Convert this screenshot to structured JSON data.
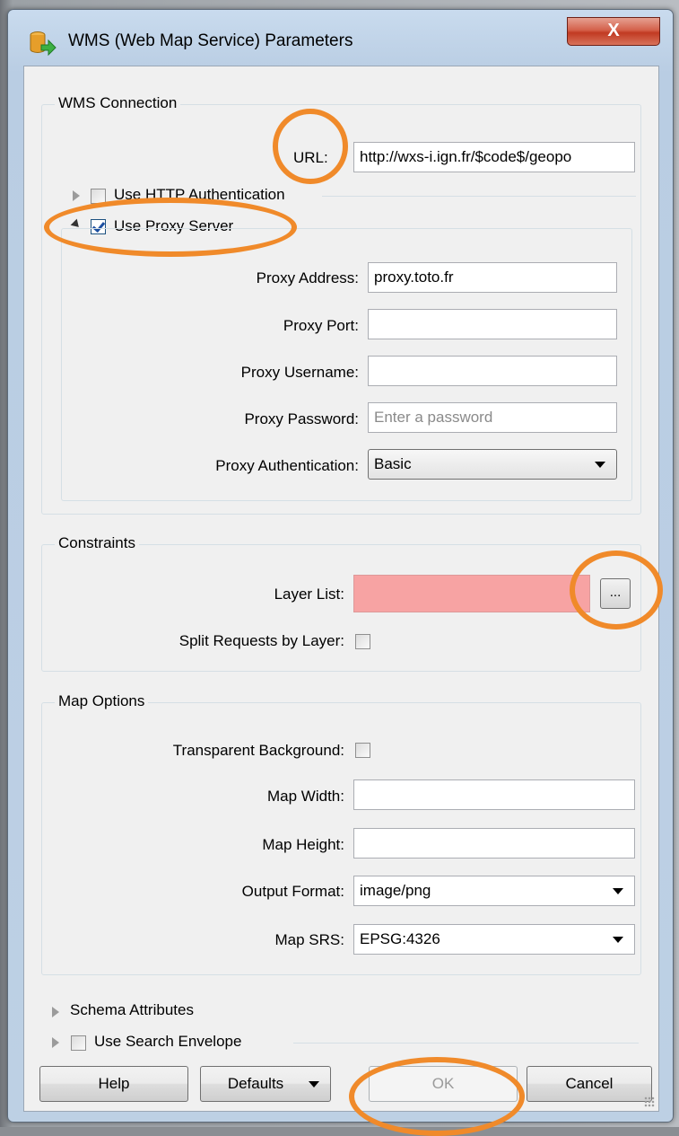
{
  "window": {
    "title": "WMS (Web Map Service) Parameters",
    "close_glyph": "X"
  },
  "wms_connection": {
    "group_title": "WMS Connection",
    "url_label": "URL:",
    "url_value": "http://wxs-i.ign.fr/$code$/geopo",
    "http_auth_label": "Use HTTP Authentication",
    "http_auth_checked": false,
    "proxy_label": "Use Proxy Server",
    "proxy_checked": true,
    "proxy_address_label": "Proxy Address:",
    "proxy_address_value": "proxy.toto.fr",
    "proxy_port_label": "Proxy Port:",
    "proxy_port_value": "",
    "proxy_username_label": "Proxy Username:",
    "proxy_username_value": "",
    "proxy_password_label": "Proxy Password:",
    "proxy_password_placeholder": "Enter a password",
    "proxy_auth_label": "Proxy Authentication:",
    "proxy_auth_value": "Basic"
  },
  "constraints": {
    "group_title": "Constraints",
    "layer_list_label": "Layer List:",
    "layer_list_value": "",
    "browse_label": "...",
    "split_label": "Split Requests by Layer:",
    "split_checked": false
  },
  "map_options": {
    "group_title": "Map Options",
    "transparent_label": "Transparent Background:",
    "transparent_checked": false,
    "width_label": "Map Width:",
    "width_value": "",
    "height_label": "Map Height:",
    "height_value": "",
    "format_label": "Output Format:",
    "format_value": "image/png",
    "srs_label": "Map SRS:",
    "srs_value": "EPSG:4326"
  },
  "schema_attributes_label": "Schema Attributes",
  "search_envelope_label": "Use Search Envelope",
  "search_envelope_checked": false,
  "buttons": {
    "help": "Help",
    "defaults": "Defaults",
    "ok": "OK",
    "cancel": "Cancel"
  },
  "colors": {
    "highlight": "#f08a2a",
    "error_field": "#f7a3a3",
    "check_blue": "#1c4fa0"
  }
}
